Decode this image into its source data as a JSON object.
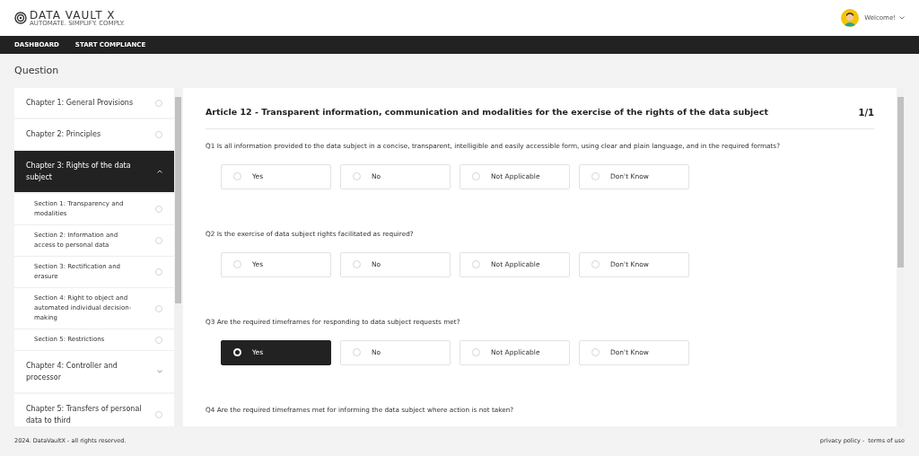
{
  "brand": {
    "name": "DATA VAULT X",
    "tagline": "AUTOMATE. SIMPLIFY. COMPLY."
  },
  "user": {
    "greeting": "Welcome!"
  },
  "nav": [
    {
      "label": "DASHBOARD"
    },
    {
      "label": "START COMPLIANCE"
    }
  ],
  "page_title": "Question",
  "sidebar": {
    "items": [
      {
        "label": "Chapter 1: General Provisions",
        "kind": "status",
        "selected": false
      },
      {
        "label": "Chapter 2: Principles",
        "kind": "status",
        "selected": false
      },
      {
        "label": "Chapter 3: Rights of the data subject",
        "kind": "expandable",
        "selected": true,
        "expanded": true,
        "children": [
          {
            "label": "Section 1: Transparency and modalities"
          },
          {
            "label": "Section 2: Information and access to personal data"
          },
          {
            "label": "Section 3: Rectification and erasure"
          },
          {
            "label": "Section 4: Right to object and automated individual decision-making"
          },
          {
            "label": "Section 5: Restrictions"
          }
        ]
      },
      {
        "label": "Chapter 4: Controller and processor",
        "kind": "expandable",
        "selected": false,
        "expanded": false
      },
      {
        "label": "Chapter 5: Transfers of personal data to third",
        "kind": "status",
        "selected": false
      }
    ]
  },
  "article": {
    "title": "Article 12 - Transparent information, communication and modalities for the exercise of the rights of the data subject",
    "page": "1/1",
    "questions": [
      {
        "text": "Q1 Is all information provided to the data subject in a concise, transparent, intelligible and easily accessible form, using clear and plain language, and in the required formats?",
        "options": [
          {
            "label": "Yes",
            "selected": false
          },
          {
            "label": "No",
            "selected": false
          },
          {
            "label": "Not Applicable",
            "selected": false
          },
          {
            "label": "Don't Know",
            "selected": false
          }
        ]
      },
      {
        "text": "Q2 Is the exercise of data subject rights facilitated as required?",
        "options": [
          {
            "label": "Yes",
            "selected": false
          },
          {
            "label": "No",
            "selected": false
          },
          {
            "label": "Not Applicable",
            "selected": false
          },
          {
            "label": "Don't Know",
            "selected": false
          }
        ]
      },
      {
        "text": "Q3 Are the required timeframes for responding to data subject requests met?",
        "options": [
          {
            "label": "Yes",
            "selected": true
          },
          {
            "label": "No",
            "selected": false
          },
          {
            "label": "Not Applicable",
            "selected": false
          },
          {
            "label": "Don't Know",
            "selected": false
          }
        ]
      },
      {
        "text": "Q4 Are the required timeframes met for informing the data subject where action is not taken?"
      }
    ]
  },
  "footer": {
    "copyright": "2024. DataVaultX - all rights reserved.",
    "links": [
      {
        "label": "privacy policy -"
      },
      {
        "label": "terms of use"
      }
    ]
  }
}
